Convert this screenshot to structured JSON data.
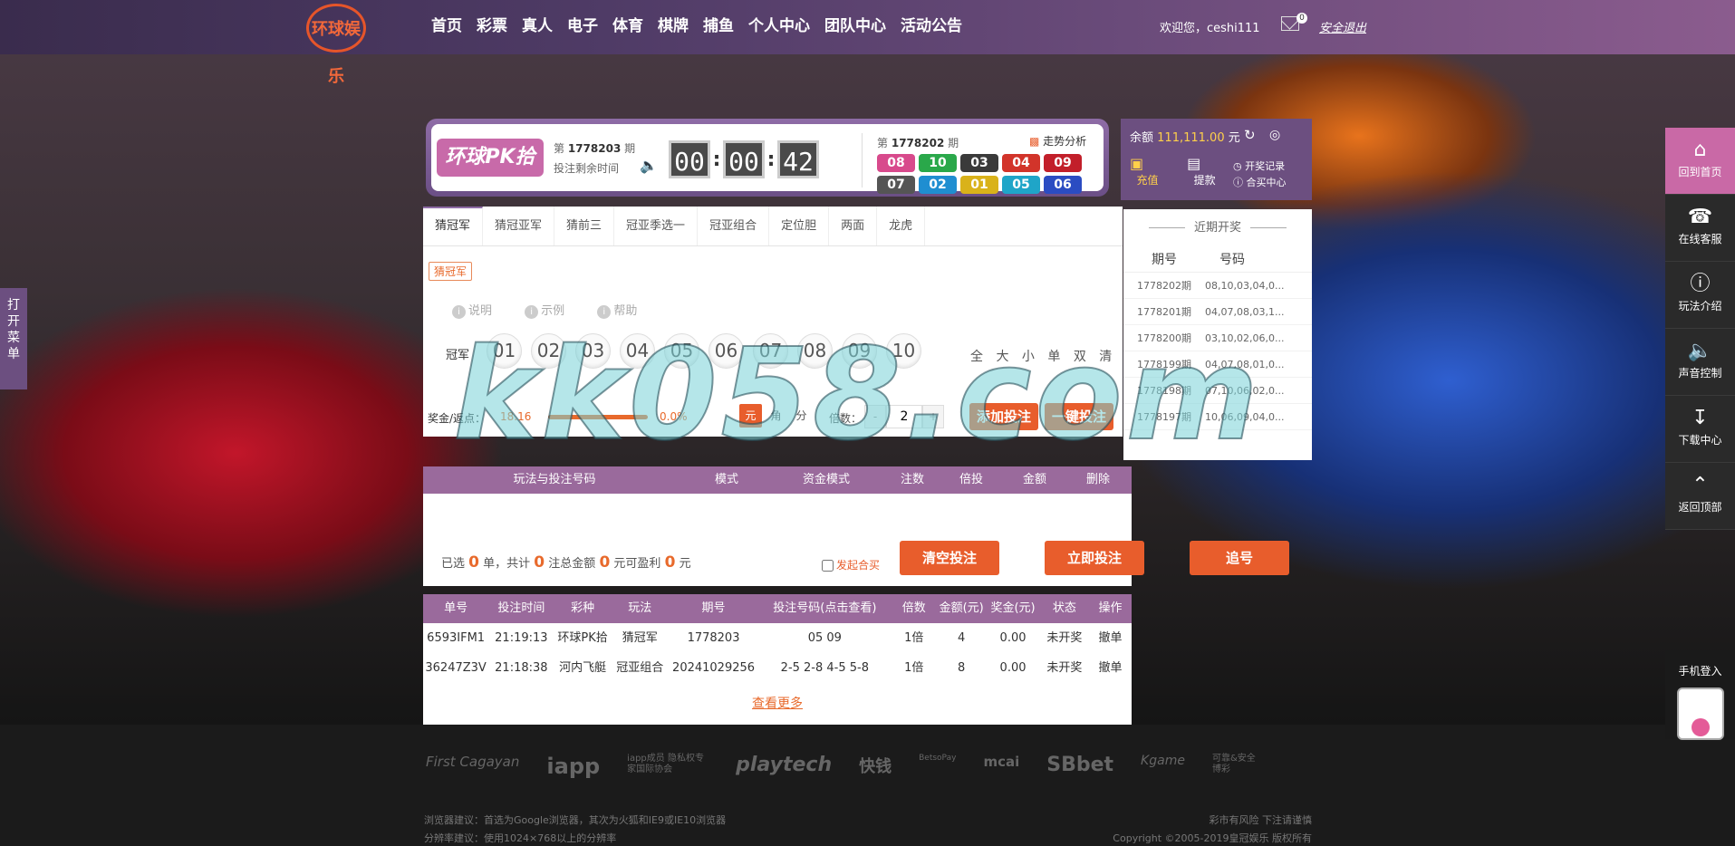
{
  "colors": {
    "accent": "#e85d2c",
    "purple": "#8e6ca6",
    "table_head": "#9a6a9c",
    "pink": "#c969a6"
  },
  "header": {
    "logo_text": "环球娱乐",
    "nav": [
      "首页",
      "彩票",
      "真人",
      "电子",
      "体育",
      "棋牌",
      "捕鱼",
      "个人中心",
      "团队中心",
      "活动公告"
    ],
    "welcome": "欢迎您，ceshi111",
    "mail_count": "0",
    "logout": "安全退出"
  },
  "lottery": {
    "logo": "环球PK拾",
    "issue_prefix": "第",
    "issue": "1778203",
    "issue_suffix": "期",
    "remain_label": "投注剩余时间",
    "countdown": [
      "00",
      "00",
      "42"
    ],
    "prev_issue_prefix": "第",
    "prev_issue": "1778202",
    "prev_issue_suffix": "期",
    "trend_label": "走势分析",
    "result": [
      "08",
      "10",
      "03",
      "04",
      "09",
      "07",
      "02",
      "01",
      "05",
      "06"
    ]
  },
  "account": {
    "balance_label": "余额",
    "balance": "111,111.00",
    "unit": "元",
    "recharge": "充值",
    "withdraw": "提款",
    "draw_record": "开奖记录",
    "hemai_center": "合买中心"
  },
  "play": {
    "tabs": [
      "猜冠军",
      "猜冠亚军",
      "猜前三",
      "冠亚季选一",
      "冠亚组合",
      "定位胆",
      "两面",
      "龙虎"
    ],
    "subtag": "猜冠军",
    "help": [
      "说明",
      "示例",
      "帮助"
    ],
    "row_label": "冠军",
    "numbers": [
      "01",
      "02",
      "03",
      "04",
      "05",
      "06",
      "07",
      "08",
      "09",
      "10"
    ],
    "filters": [
      "全",
      "大",
      "小",
      "单",
      "双",
      "清"
    ],
    "odds_label": "奖金/返点：",
    "odds_value": "18.16",
    "rebate": "0.0%",
    "modes": [
      "元",
      "角",
      "分"
    ],
    "multiplier_label": "倍数：",
    "multiplier": "2",
    "add_bet": "添加投注",
    "quick_bet": "一键投注"
  },
  "recent": {
    "title": "近期开奖",
    "headers": [
      "期号",
      "号码"
    ],
    "rows": [
      {
        "issue": "1778202期",
        "nums": "08,10,03,04,0..."
      },
      {
        "issue": "1778201期",
        "nums": "04,07,08,03,1..."
      },
      {
        "issue": "1778200期",
        "nums": "03,10,02,06,0..."
      },
      {
        "issue": "1778199期",
        "nums": "04,07,08,01,0..."
      },
      {
        "issue": "1778198期",
        "nums": "07,10,06,02,0..."
      },
      {
        "issue": "1778197期",
        "nums": "10,06,09,04,0..."
      }
    ]
  },
  "betlist": {
    "headers": [
      "玩法与投注号码",
      "模式",
      "资金模式",
      "注数",
      "倍投",
      "金额",
      "删除"
    ],
    "sum_prefix": "已选",
    "count": "0",
    "sum_mid1": "单，共计",
    "notes": "0",
    "sum_mid2": "注总金额",
    "amount": "0",
    "sum_mid3": "元可盈利",
    "profit": "0",
    "sum_suffix": "元",
    "hemai": "发起合买",
    "clear": "清空投注",
    "submit": "立即投注",
    "chase": "追号"
  },
  "orders": {
    "headers": [
      "单号",
      "投注时间",
      "彩种",
      "玩法",
      "期号",
      "投注号码(点击查看)",
      "倍数",
      "金额(元)",
      "奖金(元)",
      "状态",
      "操作"
    ],
    "rows": [
      [
        "6593IFM1",
        "21:19:13",
        "环球PK拾",
        "猜冠军",
        "1778203",
        "05 09",
        "1倍",
        "4",
        "0.00",
        "未开奖",
        "撤单"
      ],
      [
        "36247Z3V",
        "21:18:38",
        "河内飞艇",
        "冠亚组合",
        "20241029256",
        "2-5 2-8 4-5 5-8",
        "1倍",
        "8",
        "0.00",
        "未开奖",
        "撤单"
      ]
    ],
    "more": "查看更多"
  },
  "side": {
    "open_menu": "打开菜单",
    "right": [
      "回到首页",
      "在线客服",
      "玩法介绍",
      "声音控制",
      "下载中心",
      "返回顶部"
    ],
    "mobile": "手机登入"
  },
  "watermark": "kk058.com",
  "footer": {
    "partners": [
      "First Cagayan",
      "iapp",
      "iapp成员 隐私权专家国际协会",
      "playtech",
      "快钱",
      "BetsoPay",
      "mcai",
      "SBbet",
      "Kgame",
      "可靠&安全 博彩"
    ],
    "browser_tip": "浏览器建议：首选为Google浏览器，其次为火狐和IE9或IE10浏览器",
    "resolution_tip": "分辨率建议：使用1024×768以上的分辨率",
    "risk": "彩市有风险 下注请谨慎",
    "copyright": "Copyright ©2005-2019皇冠娱乐 版权所有"
  }
}
